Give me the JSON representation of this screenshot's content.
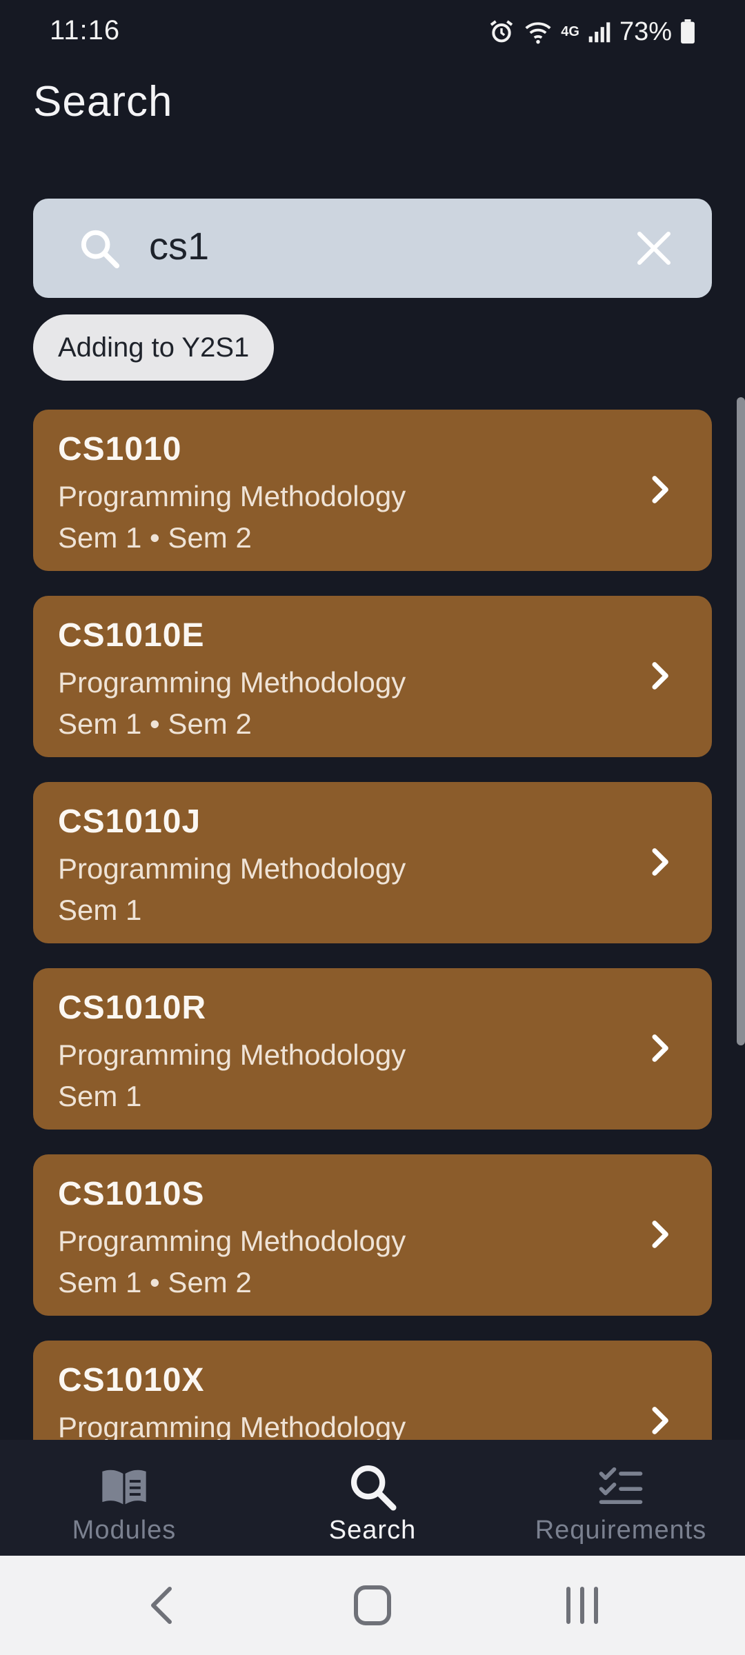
{
  "status_bar": {
    "time": "11:16",
    "network": "4G",
    "battery": "73%"
  },
  "header": {
    "title": "Search"
  },
  "search": {
    "value": "cs1",
    "icon": "search-icon",
    "clear_icon": "close-icon"
  },
  "chip": {
    "label": "Adding to Y2S1"
  },
  "results": [
    {
      "code": "CS1010",
      "title": "Programming Methodology",
      "semesters": "Sem 1 • Sem 2"
    },
    {
      "code": "CS1010E",
      "title": "Programming Methodology",
      "semesters": "Sem 1 • Sem 2"
    },
    {
      "code": "CS1010J",
      "title": "Programming Methodology",
      "semesters": "Sem 1"
    },
    {
      "code": "CS1010R",
      "title": "Programming Methodology",
      "semesters": "Sem 1"
    },
    {
      "code": "CS1010S",
      "title": "Programming Methodology",
      "semesters": "Sem 1 • Sem 2"
    },
    {
      "code": "CS1010X",
      "title": "Programming Methodology",
      "semesters": ""
    }
  ],
  "bottom_nav": {
    "items": [
      {
        "label": "Modules",
        "icon": "book-icon",
        "active": false
      },
      {
        "label": "Search",
        "icon": "search-icon",
        "active": true
      },
      {
        "label": "Requirements",
        "icon": "checklist-icon",
        "active": false
      }
    ]
  },
  "colors": {
    "background": "#161923",
    "card": "#8b5c2b",
    "search_box": "#cdd5df",
    "chip": "#e7e7e9",
    "nav_background": "#1b1e29"
  }
}
